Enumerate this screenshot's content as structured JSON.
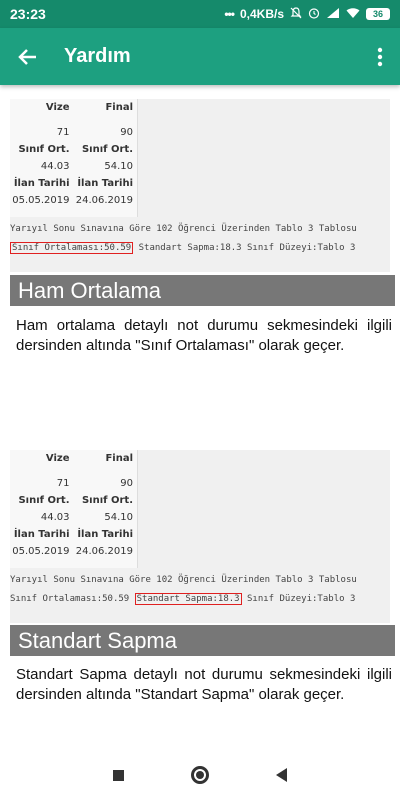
{
  "status_bar": {
    "time": "23:23",
    "network_speed": "0,4KB/s",
    "battery": "36"
  },
  "app_bar": {
    "title": "Yardım",
    "back_icon": "arrow-back-icon",
    "menu_icon": "more-vert-icon"
  },
  "sections": [
    {
      "table": {
        "head1": "Vize",
        "head2": "Final",
        "score1": "71",
        "score2": "90",
        "avg_label1": "Sınıf Ort.",
        "avg_label2": "Sınıf Ort.",
        "avg1": "44.03",
        "avg2": "54.10",
        "date_label1": "İlan Tarihi",
        "date_label2": "İlan Tarihi",
        "date1": "05.05.2019",
        "date2": "24.06.2019"
      },
      "line1": "Yarıyıl Sonu Sınavına Göre 102 Öğrenci Üzerinden Tablo 3 Tablosu",
      "line2_part1": "Sınıf Ortalaması:50.59",
      "line2_part2": " Standart Sapma:18.3",
      "line2_part3": " Sınıf Düzeyi:Tablo 3",
      "header": "Ham Ortalama",
      "description": "Ham ortalama detaylı not durumu sekmesindeki ilgili dersinden altında \"Sınıf Ortalaması\" olarak geçer."
    },
    {
      "table": {
        "head1": "Vize",
        "head2": "Final",
        "score1": "71",
        "score2": "90",
        "avg_label1": "Sınıf Ort.",
        "avg_label2": "Sınıf Ort.",
        "avg1": "44.03",
        "avg2": "54.10",
        "date_label1": "İlan Tarihi",
        "date_label2": "İlan Tarihi",
        "date1": "05.05.2019",
        "date2": "24.06.2019"
      },
      "line1": "Yarıyıl Sonu Sınavına Göre 102 Öğrenci Üzerinden Tablo 3 Tablosu",
      "line2_part1": "Sınıf Ortalaması:50.59 ",
      "line2_part2": "Standart Sapma:18.3",
      "line2_part3": " Sınıf Düzeyi:Tablo 3",
      "header": "Standart Sapma",
      "description": "Standart Sapma detaylı not durumu sekmesindeki ilgili dersinden altında \"Standart Sapma\" olarak geçer."
    }
  ],
  "nav": {
    "recents_icon": "square-icon",
    "home_icon": "circle-icon",
    "back_icon": "triangle-back-icon"
  }
}
